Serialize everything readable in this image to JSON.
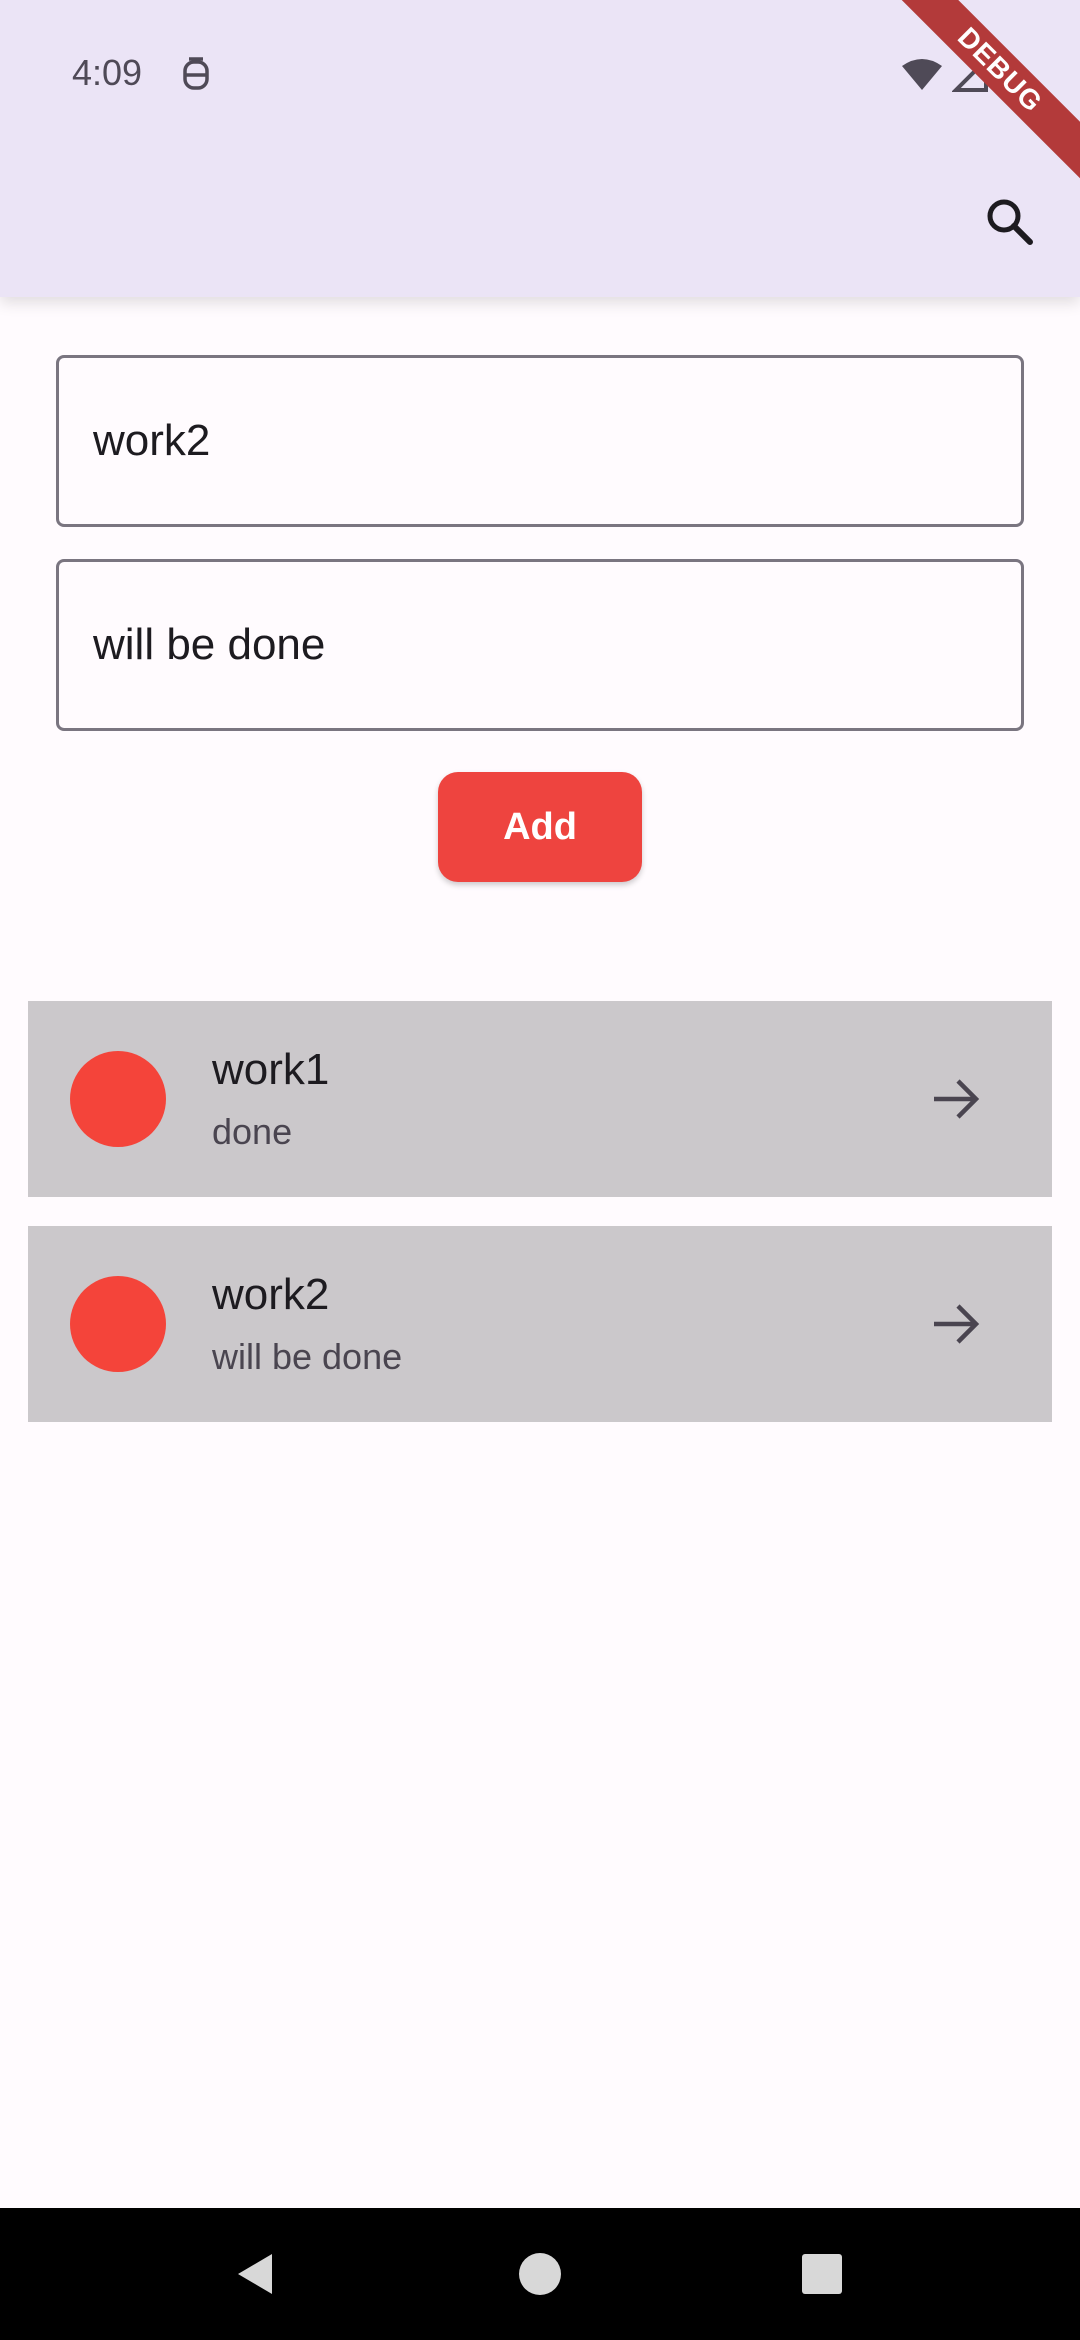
{
  "status_bar": {
    "time": "4:09"
  },
  "debug_banner": "DEBUG",
  "form": {
    "title_value": "work2",
    "description_value": "will be done",
    "add_label": "Add"
  },
  "items": [
    {
      "title": "work1",
      "subtitle": "done"
    },
    {
      "title": "work2",
      "subtitle": "will be done"
    }
  ],
  "colors": {
    "app_bar": "#ebe4f6",
    "accent": "#ee443f",
    "dot": "#f4443a",
    "item_bg": "#cbc8cb"
  },
  "icons": {
    "search": "search-icon",
    "arrow": "arrow-forward-icon",
    "nav_back": "back-triangle-icon",
    "nav_home": "home-circle-icon",
    "nav_recent": "recent-square-icon"
  }
}
